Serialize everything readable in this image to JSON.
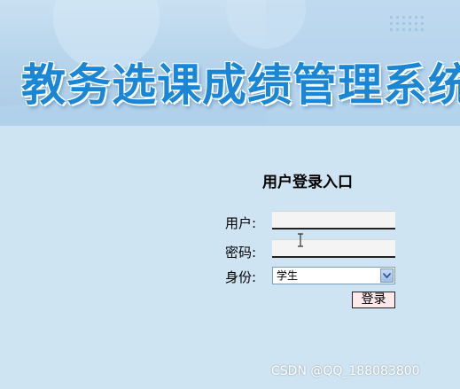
{
  "banner": {
    "title": "教务选课成绩管理系统"
  },
  "login": {
    "title": "用户登录入口",
    "user_label": "用户:",
    "user_value": "",
    "password_label": "密码:",
    "password_value": "",
    "role_label": "身份:",
    "role_selected": "学生",
    "submit_label": "登录"
  },
  "icons": {
    "dropdown": "chevron-down-icon",
    "cursor": "text-cursor-icon"
  },
  "colors": {
    "background": "#cfe4f3",
    "banner_title": "#1a86d6",
    "button_bg": "#fde8ea"
  },
  "watermark": "CSDN @QQ_188083800"
}
